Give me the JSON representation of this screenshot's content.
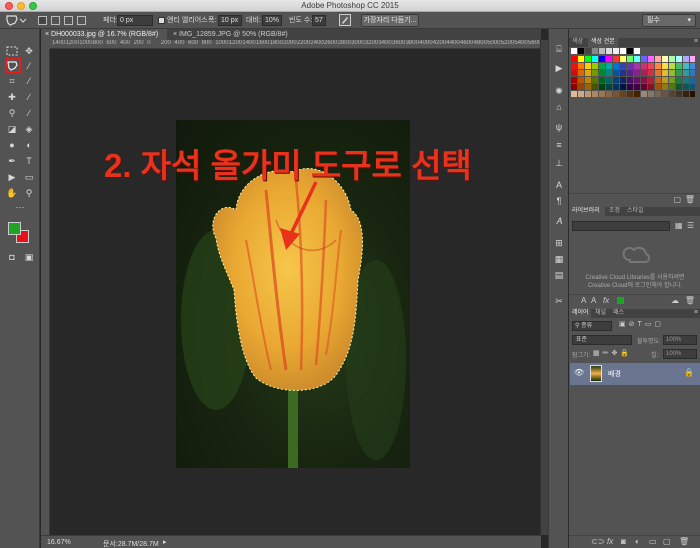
{
  "app": {
    "title": "Adobe Photoshop CC 2015"
  },
  "options_bar": {
    "feather_label": "페더:",
    "feather_value": "0 px",
    "antialias_label": "앤티 앨리어스",
    "width_label": "폭:",
    "width_value": "10 px",
    "contrast_label": "대비:",
    "contrast_value": "10%",
    "frequency_label": "빈도 수:",
    "frequency_value": "57",
    "refine_edge_button": "가장자리 다듬기...",
    "workspace": "필수"
  },
  "documents": {
    "tabs": [
      {
        "label": "DH000033.jpg @ 16.7% (RGB/8#)",
        "active": true
      },
      {
        "label": "IMG_12859.JPG @ 50% (RGB/8#)",
        "active": false
      }
    ]
  },
  "ruler": {
    "labels": [
      "1400",
      "1200",
      "1000",
      "800",
      "600",
      "400",
      "200",
      "0",
      "200",
      "400",
      "600",
      "800",
      "1000",
      "1200",
      "1400",
      "1600",
      "1800",
      "2000",
      "2200",
      "2400",
      "2600",
      "2800",
      "3000",
      "3200",
      "3400",
      "3600",
      "3800",
      "4000",
      "4200",
      "4400",
      "4600",
      "4800",
      "5000",
      "5200",
      "5400",
      "5600"
    ]
  },
  "annotation": {
    "text": "2. 자석 올가미 도구로 선택"
  },
  "status_bar": {
    "zoom": "16.67%",
    "doc_info": "문서:28.7M/28.7M"
  },
  "colors": {
    "foreground": "#1ea324",
    "background": "#e8101b",
    "annotation": "#e8321c",
    "highlight": "#e02020"
  },
  "panels": {
    "color_tabs": [
      "색상",
      "색상 견본"
    ],
    "library_tabs": [
      "라이브러리",
      "조정",
      "스타일"
    ],
    "library_message_line1": "Creative Cloud Libraries를 사용하려면",
    "library_message_line2": "Creative Cloud에 로그인해야 합니다.",
    "layer_tabs": [
      "레이어",
      "채널",
      "패스"
    ],
    "layer_filter": "종류",
    "blend_mode": "표준",
    "opacity_label": "불투명도:",
    "opacity_value": "100%",
    "lock_label": "잠그기:",
    "fill_label": "칠:",
    "fill_value": "100%",
    "layer_name": "배경"
  }
}
